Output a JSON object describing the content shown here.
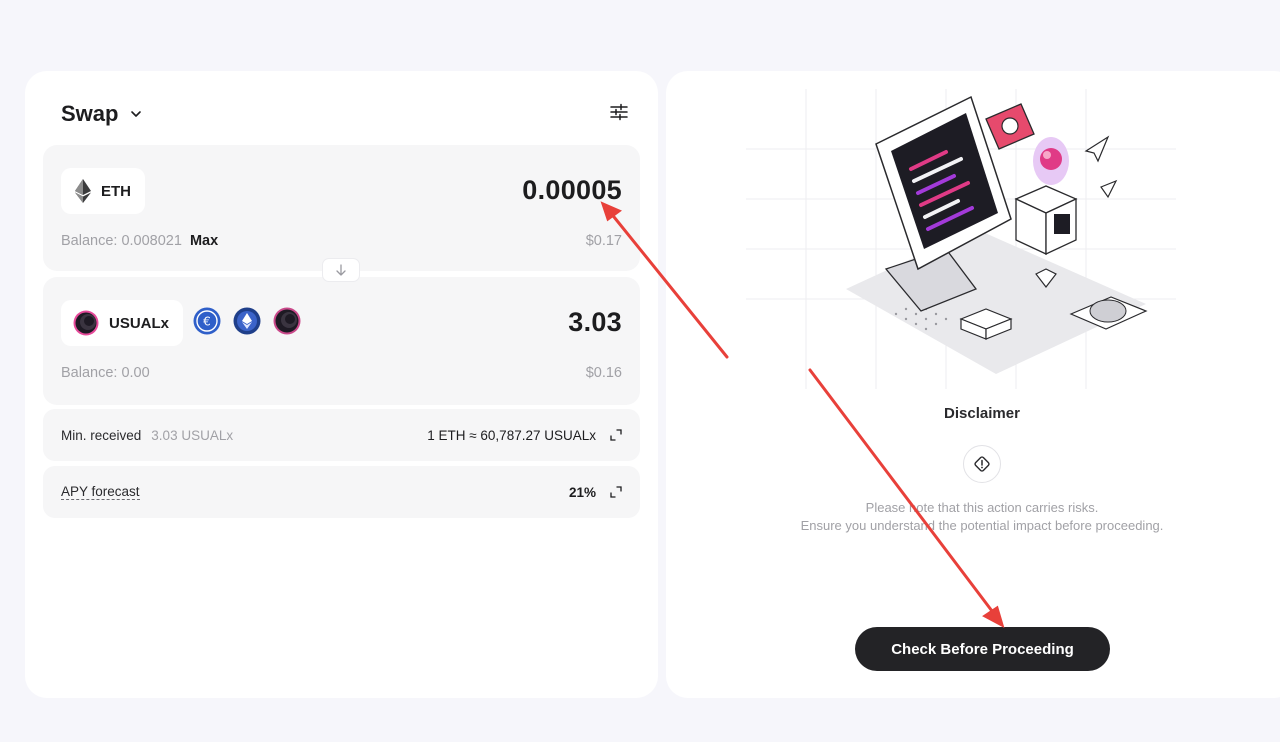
{
  "swap": {
    "title": "Swap",
    "from": {
      "token": "ETH",
      "amount": "0.00005",
      "balance_label": "Balance: 0.008021",
      "max_label": "Max",
      "usd": "$0.17"
    },
    "to": {
      "token": "USUALx",
      "amount": "3.03",
      "balance_label": "Balance: 0.00",
      "usd": "$0.16",
      "alt_tokens": [
        "euro-stablecoin",
        "eth-token",
        "usualx-token"
      ]
    },
    "min_received": {
      "label": "Min. received",
      "value": "3.03 USUALx",
      "rate": "1 ETH ≈ 60,787.27 USUALx"
    },
    "apy": {
      "label": "APY forecast",
      "value": "21%"
    }
  },
  "disclaimer": {
    "title": "Disclaimer",
    "line1": "Please note that this action carries risks.",
    "line2": "Ensure you understand the potential impact before proceeding.",
    "cta_label": "Check Before Proceeding"
  },
  "colors": {
    "page_bg": "#f6f6fb",
    "card_bg": "#ffffff",
    "panel_bg": "#f6f6f7",
    "cta_bg": "#232326",
    "annotation_arrow": "#e8403a"
  }
}
